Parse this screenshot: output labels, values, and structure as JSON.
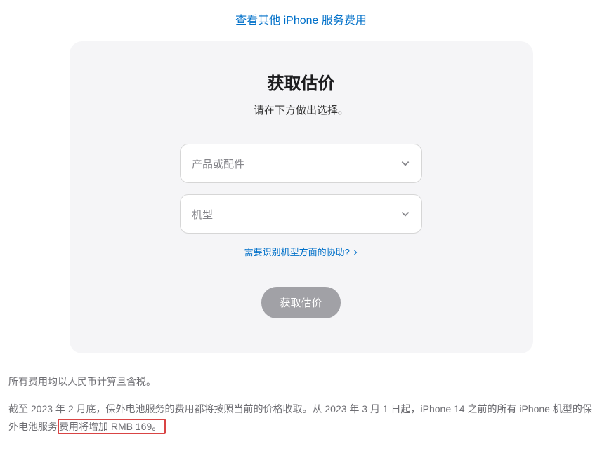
{
  "topLink": {
    "label": "查看其他 iPhone 服务费用"
  },
  "card": {
    "title": "获取估价",
    "subtitle": "请在下方做出选择。",
    "select1": {
      "placeholder": "产品或配件"
    },
    "select2": {
      "placeholder": "机型"
    },
    "helpLink": "需要识别机型方面的协助?",
    "submit": "获取估价"
  },
  "footer": {
    "line1": "所有费用均以人民币计算且含税。",
    "line2_pre": "截至 2023 年 2 月底，保外电池服务的费用都将按照当前的价格收取。从 2023 年 3 月 1 日起，iPhone 14 之前的所有 iPhone 机型的保外电池服务",
    "line2_highlight": "费用将增加 RMB 169。"
  }
}
